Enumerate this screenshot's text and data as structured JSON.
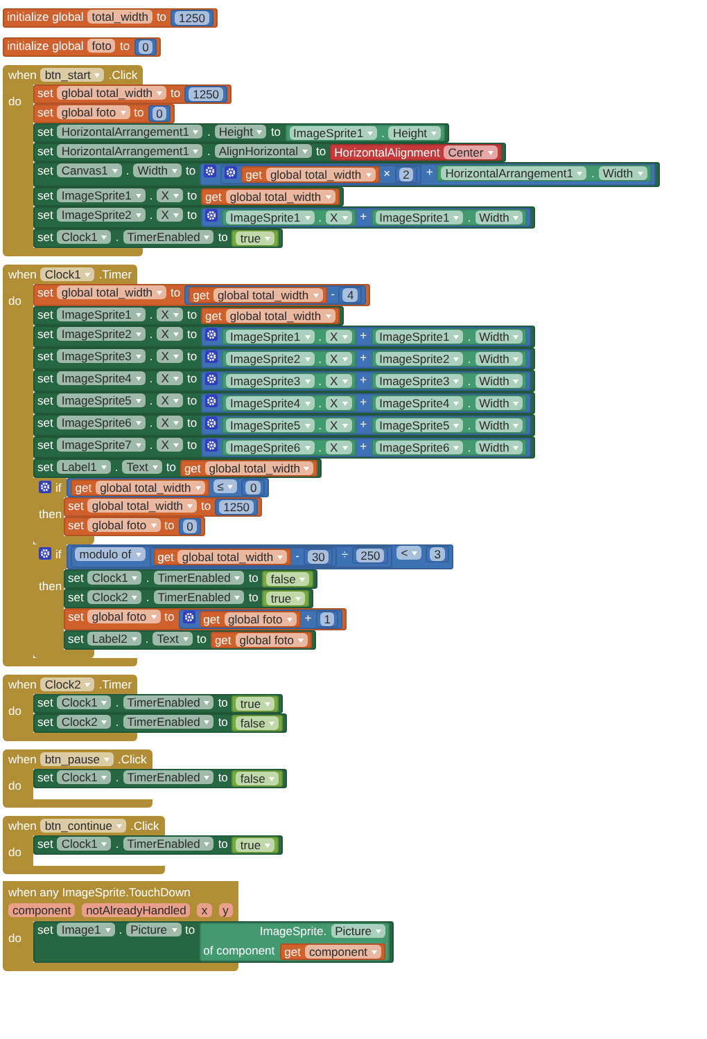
{
  "blocks": [
    {
      "kind": "global",
      "label": "initialize global",
      "name": "total_width",
      "to": "to",
      "value": {
        "kind": "number",
        "text": "1250"
      }
    },
    {
      "kind": "global",
      "label": "initialize global",
      "name": "foto",
      "to": "to",
      "value": {
        "kind": "number",
        "text": "0"
      }
    },
    {
      "kind": "event",
      "when": "when",
      "component": "btn_start",
      "event": ".Click",
      "do": "do",
      "body": [
        {
          "kind": "set_global",
          "set": "set",
          "variable": "global total_width",
          "to": "to",
          "value": {
            "kind": "number",
            "text": "1250"
          }
        },
        {
          "kind": "set_global",
          "set": "set",
          "variable": "global foto",
          "to": "to",
          "value": {
            "kind": "number",
            "text": "0"
          }
        },
        {
          "kind": "set_prop",
          "set": "set",
          "component": "HorizontalArrangement1",
          "dot": ".",
          "property": "Height",
          "to": "to",
          "value": {
            "kind": "prop",
            "component": "ImageSprite1",
            "dot": ".",
            "property": "Height"
          }
        },
        {
          "kind": "set_prop",
          "set": "set",
          "component": "HorizontalArrangement1",
          "dot": ".",
          "property": "AlignHorizontal",
          "to": "to",
          "value": {
            "kind": "enum",
            "label": "HorizontalAlignment",
            "value": "Center"
          }
        },
        {
          "kind": "set_prop",
          "set": "set",
          "component": "Canvas1",
          "dot": ".",
          "property": "Width",
          "to": "to",
          "value": {
            "kind": "math",
            "gear": true,
            "items": [
              {
                "kind": "math",
                "gear": true,
                "items": [
                  {
                    "kind": "get",
                    "get": "get",
                    "variable": "global total_width"
                  },
                  {
                    "kind": "number",
                    "text": "2"
                  }
                ],
                "ops": [
                  "×"
                ]
              },
              {
                "kind": "prop",
                "component": "HorizontalArrangement1",
                "dot": ".",
                "property": "Width"
              }
            ],
            "ops": [
              "+"
            ]
          }
        },
        {
          "kind": "set_prop",
          "set": "set",
          "component": "ImageSprite1",
          "dot": ".",
          "property": "X",
          "to": "to",
          "value": {
            "kind": "get",
            "get": "get",
            "variable": "global total_width"
          }
        },
        {
          "kind": "set_prop",
          "set": "set",
          "component": "ImageSprite2",
          "dot": ".",
          "property": "X",
          "to": "to",
          "value": {
            "kind": "math",
            "gear": true,
            "items": [
              {
                "kind": "prop",
                "component": "ImageSprite1",
                "dot": ".",
                "property": "X"
              },
              {
                "kind": "prop",
                "component": "ImageSprite1",
                "dot": ".",
                "property": "Width"
              }
            ],
            "ops": [
              "+"
            ]
          }
        },
        {
          "kind": "set_prop",
          "set": "set",
          "component": "Clock1",
          "dot": ".",
          "property": "TimerEnabled",
          "to": "to",
          "value": {
            "kind": "bool",
            "value": "true"
          }
        }
      ]
    },
    {
      "kind": "event",
      "when": "when",
      "component": "Clock1",
      "event": ".Timer",
      "do": "do",
      "body": [
        {
          "kind": "set_global",
          "set": "set",
          "variable": "global total_width",
          "to": "to",
          "value": {
            "kind": "math",
            "gear": false,
            "items": [
              {
                "kind": "get",
                "get": "get",
                "variable": "global total_width"
              },
              {
                "kind": "number",
                "text": "4"
              }
            ],
            "ops": [
              "-"
            ]
          }
        },
        {
          "kind": "set_prop",
          "set": "set",
          "component": "ImageSprite1",
          "dot": ".",
          "property": "X",
          "to": "to",
          "value": {
            "kind": "get",
            "get": "get",
            "variable": "global total_width"
          }
        },
        {
          "kind": "set_prop",
          "set": "set",
          "component": "ImageSprite2",
          "dot": ".",
          "property": "X",
          "to": "to",
          "value": {
            "kind": "math",
            "gear": true,
            "items": [
              {
                "kind": "prop",
                "component": "ImageSprite1",
                "dot": ".",
                "property": "X"
              },
              {
                "kind": "prop",
                "component": "ImageSprite1",
                "dot": ".",
                "property": "Width"
              }
            ],
            "ops": [
              "+"
            ]
          }
        },
        {
          "kind": "set_prop",
          "set": "set",
          "component": "ImageSprite3",
          "dot": ".",
          "property": "X",
          "to": "to",
          "value": {
            "kind": "math",
            "gear": true,
            "items": [
              {
                "kind": "prop",
                "component": "ImageSprite2",
                "dot": ".",
                "property": "X"
              },
              {
                "kind": "prop",
                "component": "ImageSprite2",
                "dot": ".",
                "property": "Width"
              }
            ],
            "ops": [
              "+"
            ]
          }
        },
        {
          "kind": "set_prop",
          "set": "set",
          "component": "ImageSprite4",
          "dot": ".",
          "property": "X",
          "to": "to",
          "value": {
            "kind": "math",
            "gear": true,
            "items": [
              {
                "kind": "prop",
                "component": "ImageSprite3",
                "dot": ".",
                "property": "X"
              },
              {
                "kind": "prop",
                "component": "ImageSprite3",
                "dot": ".",
                "property": "Width"
              }
            ],
            "ops": [
              "+"
            ]
          }
        },
        {
          "kind": "set_prop",
          "set": "set",
          "component": "ImageSprite5",
          "dot": ".",
          "property": "X",
          "to": "to",
          "value": {
            "kind": "math",
            "gear": true,
            "items": [
              {
                "kind": "prop",
                "component": "ImageSprite4",
                "dot": ".",
                "property": "X"
              },
              {
                "kind": "prop",
                "component": "ImageSprite4",
                "dot": ".",
                "property": "Width"
              }
            ],
            "ops": [
              "+"
            ]
          }
        },
        {
          "kind": "set_prop",
          "set": "set",
          "component": "ImageSprite6",
          "dot": ".",
          "property": "X",
          "to": "to",
          "value": {
            "kind": "math",
            "gear": true,
            "items": [
              {
                "kind": "prop",
                "component": "ImageSprite5",
                "dot": ".",
                "property": "X"
              },
              {
                "kind": "prop",
                "component": "ImageSprite5",
                "dot": ".",
                "property": "Width"
              }
            ],
            "ops": [
              "+"
            ]
          }
        },
        {
          "kind": "set_prop",
          "set": "set",
          "component": "ImageSprite7",
          "dot": ".",
          "property": "X",
          "to": "to",
          "value": {
            "kind": "math",
            "gear": true,
            "items": [
              {
                "kind": "prop",
                "component": "ImageSprite6",
                "dot": ".",
                "property": "X"
              },
              {
                "kind": "prop",
                "component": "ImageSprite6",
                "dot": ".",
                "property": "Width"
              }
            ],
            "ops": [
              "+"
            ]
          }
        },
        {
          "kind": "set_prop",
          "set": "set",
          "component": "Label1",
          "dot": ".",
          "property": "Text",
          "to": "to",
          "value": {
            "kind": "get",
            "get": "get",
            "variable": "global total_width"
          }
        },
        {
          "kind": "if",
          "gear": true,
          "if": "if",
          "condition": {
            "kind": "compare",
            "op": "≤",
            "items": [
              {
                "kind": "get",
                "get": "get",
                "variable": "global total_width"
              },
              {
                "kind": "number",
                "text": "0"
              }
            ]
          },
          "then": "then",
          "body": [
            {
              "kind": "set_global",
              "set": "set",
              "variable": "global total_width",
              "to": "to",
              "value": {
                "kind": "number",
                "text": "1250"
              }
            },
            {
              "kind": "set_global",
              "set": "set",
              "variable": "global foto",
              "to": "to",
              "value": {
                "kind": "number",
                "text": "0"
              }
            }
          ]
        },
        {
          "kind": "if",
          "gear": true,
          "if": "if",
          "condition": {
            "kind": "compare",
            "op": "<",
            "items": [
              {
                "kind": "modulo",
                "label": "modulo of",
                "items": [
                  {
                    "kind": "math",
                    "gear": false,
                    "items": [
                      {
                        "kind": "get",
                        "get": "get",
                        "variable": "global total_width"
                      },
                      {
                        "kind": "number",
                        "text": "30"
                      }
                    ],
                    "ops": [
                      "-"
                    ]
                  },
                  {
                    "kind": "number",
                    "text": "250"
                  }
                ],
                "ops": [
                  "÷"
                ]
              },
              {
                "kind": "number",
                "text": "3"
              }
            ]
          },
          "then": "then",
          "body": [
            {
              "kind": "set_prop",
              "set": "set",
              "component": "Clock1",
              "dot": ".",
              "property": "TimerEnabled",
              "to": "to",
              "value": {
                "kind": "bool",
                "value": "false"
              }
            },
            {
              "kind": "set_prop",
              "set": "set",
              "component": "Clock2",
              "dot": ".",
              "property": "TimerEnabled",
              "to": "to",
              "value": {
                "kind": "bool",
                "value": "true"
              }
            },
            {
              "kind": "set_global",
              "set": "set",
              "variable": "global foto",
              "to": "to",
              "value": {
                "kind": "math",
                "gear": true,
                "items": [
                  {
                    "kind": "get",
                    "get": "get",
                    "variable": "global foto"
                  },
                  {
                    "kind": "number",
                    "text": "1"
                  }
                ],
                "ops": [
                  "+"
                ]
              }
            },
            {
              "kind": "set_prop",
              "set": "set",
              "component": "Label2",
              "dot": ".",
              "property": "Text",
              "to": "to",
              "value": {
                "kind": "get",
                "get": "get",
                "variable": "global foto"
              }
            }
          ]
        }
      ]
    },
    {
      "kind": "event",
      "when": "when",
      "component": "Clock2",
      "event": ".Timer",
      "do": "do",
      "body": [
        {
          "kind": "set_prop",
          "set": "set",
          "component": "Clock1",
          "dot": ".",
          "property": "TimerEnabled",
          "to": "to",
          "value": {
            "kind": "bool",
            "value": "true"
          }
        },
        {
          "kind": "set_prop",
          "set": "set",
          "component": "Clock2",
          "dot": ".",
          "property": "TimerEnabled",
          "to": "to",
          "value": {
            "kind": "bool",
            "value": "false"
          }
        }
      ]
    },
    {
      "kind": "event",
      "when": "when",
      "component": "btn_pause",
      "event": ".Click",
      "do": "do",
      "body": [
        {
          "kind": "set_prop",
          "set": "set",
          "component": "Clock1",
          "dot": ".",
          "property": "TimerEnabled",
          "to": "to",
          "value": {
            "kind": "bool",
            "value": "false"
          }
        }
      ]
    },
    {
      "kind": "event",
      "when": "when",
      "component": "btn_continue",
      "event": ".Click",
      "do": "do",
      "body": [
        {
          "kind": "set_prop",
          "set": "set",
          "component": "Clock1",
          "dot": ".",
          "property": "TimerEnabled",
          "to": "to",
          "value": {
            "kind": "bool",
            "value": "true"
          }
        }
      ]
    },
    {
      "kind": "any_event",
      "title": "when any ImageSprite.TouchDown",
      "params": [
        "component",
        "notAlreadyHandled",
        "x",
        "y"
      ],
      "do": "do",
      "body": [
        {
          "kind": "set_prop",
          "set": "set",
          "component": "Image1",
          "dot": ".",
          "property": "Picture",
          "to": "to",
          "value": {
            "kind": "any_prop",
            "label": "ImageSprite.",
            "property": "Picture",
            "of": "of component",
            "component": {
              "kind": "get",
              "get": "get",
              "variable": "component"
            }
          }
        }
      ]
    }
  ]
}
